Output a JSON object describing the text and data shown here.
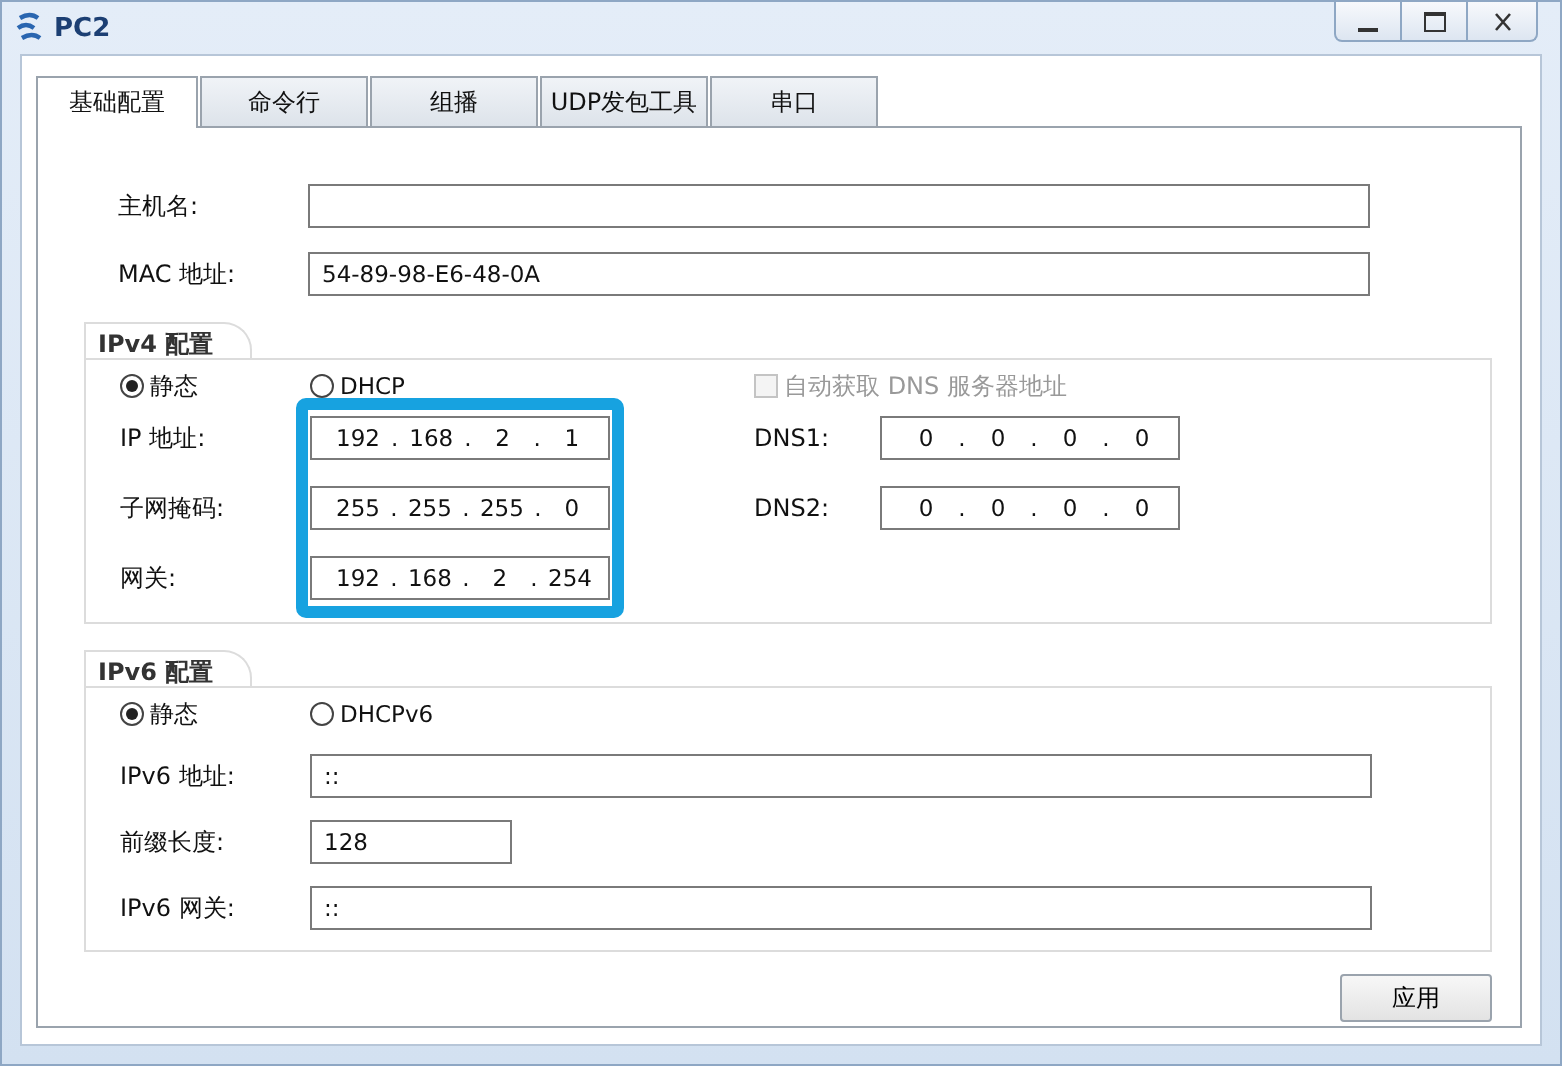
{
  "window": {
    "title": "PC2"
  },
  "tabs": [
    {
      "label": "基础配置",
      "selected": true
    },
    {
      "label": "命令行",
      "selected": false
    },
    {
      "label": "组播",
      "selected": false
    },
    {
      "label": "UDP发包工具",
      "selected": false
    },
    {
      "label": "串口",
      "selected": false
    }
  ],
  "basic": [
    {
      "label": "主机名:"
    },
    {
      "label": "MAC 地址:",
      "value": "54-89-98-E6-48-0A"
    }
  ],
  "ipv4": {
    "title": "IPv4 配置",
    "modes": [
      {
        "label": "静态",
        "selected": true
      },
      {
        "label": "DHCP",
        "selected": false
      }
    ],
    "auto_dns": {
      "label": "自动获取 DNS 服务器地址",
      "checked": false,
      "disabled": true
    },
    "fields": [
      {
        "label": "IP 地址:",
        "octets": [
          "192",
          "168",
          "2",
          "1"
        ]
      },
      {
        "label": "子网掩码:",
        "octets": [
          "255",
          "255",
          "255",
          "0"
        ]
      },
      {
        "label": "网关:",
        "octets": [
          "192",
          "168",
          "2",
          "254"
        ]
      }
    ],
    "dns": [
      {
        "label": "DNS1:",
        "octets": [
          "0",
          "0",
          "0",
          "0"
        ]
      },
      {
        "label": "DNS2:",
        "octets": [
          "0",
          "0",
          "0",
          "0"
        ]
      }
    ],
    "separator": "."
  },
  "ipv6": {
    "title": "IPv6 配置",
    "modes": [
      {
        "label": "静态",
        "selected": true
      },
      {
        "label": "DHCPv6",
        "selected": false
      }
    ],
    "fields": [
      {
        "label": "IPv6 地址:",
        "value": "::",
        "kind": "wide"
      },
      {
        "label": "前缀长度:",
        "value": "128",
        "kind": "short"
      },
      {
        "label": "IPv6 网关:",
        "value": "::",
        "kind": "wide"
      }
    ]
  },
  "apply_button": "应用"
}
